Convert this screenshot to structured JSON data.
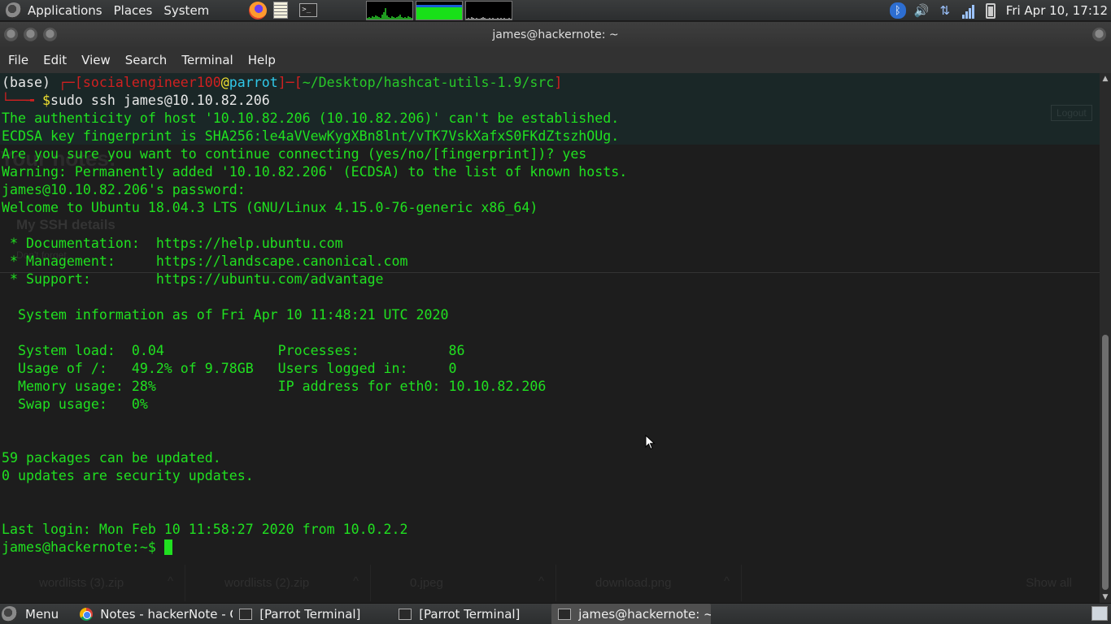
{
  "top_panel": {
    "applications": "Applications",
    "places": "Places",
    "system": "System",
    "clock": "Fri Apr 10, 17:12",
    "icons": [
      "parrot-logo-icon",
      "firefox-icon",
      "text-editor-icon",
      "terminal-icon",
      "bluetooth-icon",
      "volume-icon",
      "network-icon",
      "signal-icon",
      "battery-icon"
    ]
  },
  "window": {
    "title": "james@hackernote: ~"
  },
  "menubar": [
    "File",
    "Edit",
    "View",
    "Search",
    "Terminal",
    "Help"
  ],
  "terminal": {
    "prompt": {
      "base": "(base) ",
      "corner_top": "┌─[",
      "user": "socialengineer100",
      "at": "@",
      "host": "parrot",
      "mid": "]─[",
      "path": "~/Desktop/hashcat-utils-1.9/src",
      "close": "]",
      "corner_bottom": "└──╼ ",
      "dollar": "$",
      "command": "sudo ssh james@10.10.82.206"
    },
    "lines": [
      "The authenticity of host '10.10.82.206 (10.10.82.206)' can't be established.",
      "ECDSA key fingerprint is SHA256:le4aVVewKygXBn8lnt/vTK7VskXafxS0FKdZtszhOUg.",
      "Are you sure you want to continue connecting (yes/no/[fingerprint])? yes",
      "Warning: Permanently added '10.10.82.206' (ECDSA) to the list of known hosts.",
      "james@10.10.82.206's password: ",
      "Welcome to Ubuntu 18.04.3 LTS (GNU/Linux 4.15.0-76-generic x86_64)",
      "",
      " * Documentation:  https://help.ubuntu.com",
      " * Management:     https://landscape.canonical.com",
      " * Support:        https://ubuntu.com/advantage",
      "",
      "  System information as of Fri Apr 10 11:48:21 UTC 2020",
      "",
      "  System load:  0.04              Processes:           86",
      "  Usage of /:   49.2% of 9.78GB   Users logged in:     0",
      "  Memory usage: 28%               IP address for eth0: 10.10.82.206",
      "  Swap usage:   0%",
      "",
      "",
      "59 packages can be updated.",
      "0 updates are security updates.",
      "",
      "",
      "Last login: Mon Feb 10 11:58:27 2020 from 10.0.2.2",
      "james@hackernote:~$ "
    ]
  },
  "background_page": {
    "logout": "Logout",
    "heading": "Your notes:",
    "ssh_details": "My SSH details",
    "hint": "Don't forget...",
    "downloads": [
      "wordlists (3).zip",
      "wordlists (2).zip",
      "0.jpeg",
      "download.png"
    ],
    "show_all": "Show all"
  },
  "bottom_panel": {
    "menu": "Menu",
    "tasks": [
      {
        "label": "Notes - hackerNote - G...",
        "icon": "chrome-icon"
      },
      {
        "label": "[Parrot Terminal]",
        "icon": "terminal-icon"
      },
      {
        "label": "[Parrot Terminal]",
        "icon": "terminal-icon"
      },
      {
        "label": "james@hackernote: ~",
        "icon": "terminal-icon",
        "active": true
      }
    ]
  },
  "colors": {
    "terminal_text": "#20e020",
    "prompt_red": "#d02020",
    "prompt_cyan": "#30c8e8",
    "prompt_yellow": "#f0e030",
    "terminal_bg": "#1d1d1d"
  }
}
